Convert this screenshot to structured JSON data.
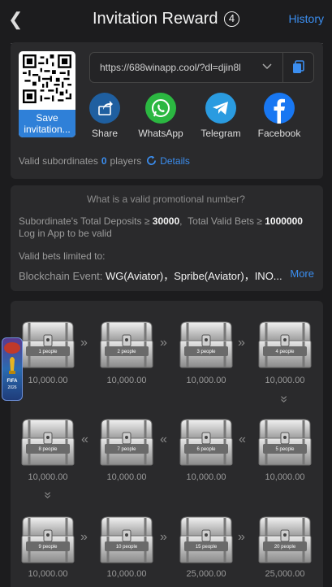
{
  "header": {
    "title": "Invitation Reward",
    "badge": "4",
    "history_label": "History"
  },
  "invite": {
    "save_label": "Save invitation...",
    "link_value": "https://688winapp.cool/?dl=djin8l"
  },
  "share": [
    {
      "label": "Share",
      "icon": "share-icon",
      "color": "#1f6fb8"
    },
    {
      "label": "WhatsApp",
      "icon": "whatsapp-icon",
      "color": "#2bb741"
    },
    {
      "label": "Telegram",
      "icon": "telegram-icon",
      "color": "#2a9be0"
    },
    {
      "label": "Facebook",
      "icon": "facebook-icon",
      "color": "#1877f2"
    }
  ],
  "subordinates": {
    "label": "Valid subordinates",
    "count": "0",
    "unit": "players",
    "details_label": "Details"
  },
  "rules": {
    "question": "What is a valid promotional number?",
    "deposits_label": "Subordinate's Total Deposits ≥",
    "deposits_value": "30000",
    "bets_label": "Total Valid Bets ≥",
    "bets_value": "1000000",
    "login_text": "Log in App to be valid",
    "limited_label": "Valid bets limited to:",
    "event_label": "Blockchain Event:",
    "event_value": "WG(Aviator)，Spribe(Aviator)，INO...",
    "more_label": "More"
  },
  "rewards": [
    {
      "label": "1 people",
      "amount": "10,000.00"
    },
    {
      "label": "2 people",
      "amount": "10,000.00"
    },
    {
      "label": "3 people",
      "amount": "10,000.00"
    },
    {
      "label": "4 people",
      "amount": "10,000.00"
    },
    {
      "label": "5 people",
      "amount": "10,000.00"
    },
    {
      "label": "6 people",
      "amount": "10,000.00"
    },
    {
      "label": "7 people",
      "amount": "10,000.00"
    },
    {
      "label": "8 people",
      "amount": "10,000.00"
    },
    {
      "label": "9 people",
      "amount": "10,000.00"
    },
    {
      "label": "10 people",
      "amount": "10,000.00"
    },
    {
      "label": "15 people",
      "amount": "25,000.00"
    },
    {
      "label": "20 people",
      "amount": "25,000.00"
    }
  ],
  "floating_badge": {
    "text": "FIFA 2026"
  },
  "colors": {
    "accent": "#3b8ef0",
    "background": "#1c1c1e",
    "card": "#2a2a2c"
  }
}
